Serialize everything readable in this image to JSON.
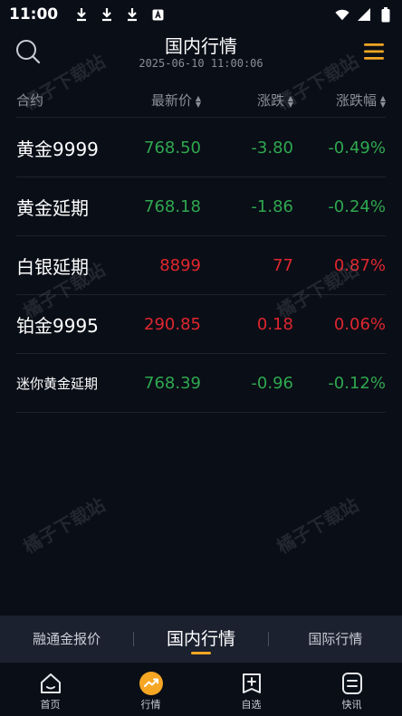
{
  "status_bar": {
    "time": "11:00"
  },
  "header": {
    "title": "国内行情",
    "datetime": "2025-06-10 11:00:06"
  },
  "columns": {
    "name": "合约",
    "price": "最新价",
    "change": "涨跌",
    "percent": "涨跌幅"
  },
  "rows": [
    {
      "name": "黄金9999",
      "price": "768.50",
      "change": "-3.80",
      "percent": "-0.49%",
      "direction": "down"
    },
    {
      "name": "黄金延期",
      "price": "768.18",
      "change": "-1.86",
      "percent": "-0.24%",
      "direction": "down"
    },
    {
      "name": "白银延期",
      "price": "8899",
      "change": "77",
      "percent": "0.87%",
      "direction": "up"
    },
    {
      "name": "铂金9995",
      "price": "290.85",
      "change": "0.18",
      "percent": "0.06%",
      "direction": "up"
    },
    {
      "name": "迷你黄金延期",
      "price": "768.39",
      "change": "-0.96",
      "percent": "-0.12%",
      "direction": "down"
    }
  ],
  "watermark": "橘子下载站",
  "tabs": [
    {
      "label": "融通金报价",
      "active": false
    },
    {
      "label": "国内行情",
      "active": true
    },
    {
      "label": "国际行情",
      "active": false
    }
  ],
  "bottom_nav": [
    {
      "label": "首页",
      "icon": "home-icon"
    },
    {
      "label": "行情",
      "icon": "market-trend-icon"
    },
    {
      "label": "自选",
      "icon": "add-favorite-icon"
    },
    {
      "label": "快讯",
      "icon": "news-flash-icon"
    }
  ],
  "colors": {
    "up": "#e0262e",
    "down": "#2fa84f",
    "accent": "#f5a623",
    "background": "#0a0e17"
  }
}
